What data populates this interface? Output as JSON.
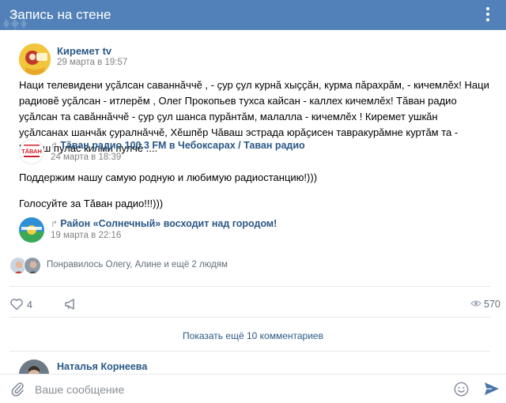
{
  "header": {
    "title": "Запись на стене"
  },
  "post": {
    "author": "Киремет tv",
    "date": "29 марта в 19:57",
    "text": "Наци телевидени уҫӑлсан саваннӑччӗ , - ҫур ҫул курнӑ хыҫҫӑн, курма пӑрахрӑм, - кичемлӗх! Наци радиовӗ уҫӑлсан - итлерӗм , Олег Прокопьев тухса кайсан - каллех кичемлӗх! Тӑван радио уҫӑлсан та савӑннӑччӗ - ҫур ҫул шанса пурӑнтӑм, малалла - кичемлӗх ! Киремет ушкӑн уҫӑлсанах шанчӑк ҫуралнӑччӗ, Хӗшпӗр Чӑваш эстрада юрӑҫисен тавракурӑмне куртӑм та - Чӑваш пулас килми пулчӗ ...."
  },
  "repost1": {
    "title": "Тӑван радио 100.3 FM в Чебоксарах / Таван радио",
    "date": "24 марта в 18:39",
    "avatar_text": "ТӐВАН",
    "text1": "Поддержим нашу самую родную и любимую радиостанцию!)))",
    "text2": "Голосуйте за Тӑван радио!!!)))"
  },
  "repost2": {
    "title": "Район «Солнечный» восходит над городом!",
    "date": "19 марта в 22:16"
  },
  "likes": {
    "text": "Понравилось Олегу, Алине и ещё 2 людям"
  },
  "actions": {
    "like_count": "4",
    "views_count": "570"
  },
  "more_comments": "Показать ещё 10 комментариев",
  "comment": {
    "author": "Наталья Корнеева"
  },
  "composer": {
    "placeholder": "Ваше сообщение"
  },
  "colors": {
    "header": "#5181b8",
    "link": "#2a5885",
    "muted": "#828282",
    "accent": "#4a76a8"
  }
}
